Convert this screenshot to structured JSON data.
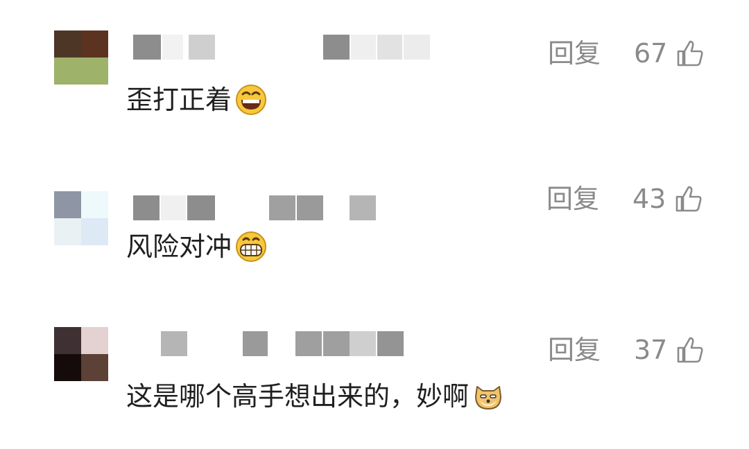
{
  "comments": [
    {
      "text": "歪打正着",
      "emoji": "grinning-face-icon",
      "reply_label": "回复",
      "like_count": "67",
      "avatar_colors": [
        "#4e3626",
        "#5b3320",
        "#9eb26a",
        "#9eb26a"
      ]
    },
    {
      "text": "风险对冲",
      "emoji": "grinning-teeth-icon",
      "reply_label": "回复",
      "like_count": "43",
      "avatar_colors": [
        "#8e96a6",
        "#eef9fb",
        "#eaf1f5",
        "#dde9f4"
      ]
    },
    {
      "text": "这是哪个高手想出来的，妙啊",
      "emoji": "doge-icon",
      "reply_label": "回复",
      "like_count": "37",
      "avatar_colors": [
        "#3e3033",
        "#e3d2d1",
        "#160b0b",
        "#5b4136"
      ]
    }
  ],
  "colors": {
    "text": "#1f1f1f",
    "meta": "#8a8a8a",
    "emoji_face": "#f8c83c",
    "doge_face": "#f2c36a"
  }
}
